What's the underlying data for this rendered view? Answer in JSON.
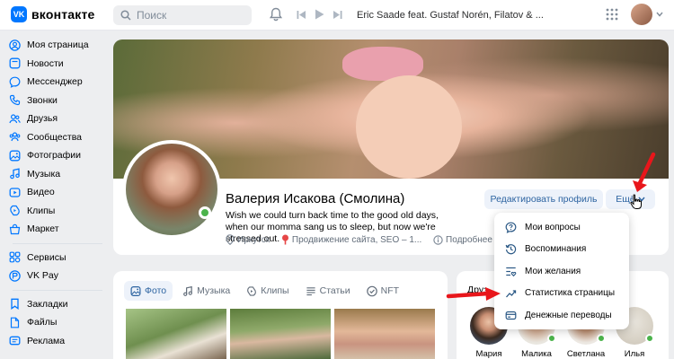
{
  "header": {
    "logo_text": "вконтакте",
    "logo_mark": "VK",
    "search_placeholder": "Поиск",
    "track": "Eric Saade feat. Gustaf Norén, Filatov & ..."
  },
  "sidebar": {
    "group1": [
      {
        "label": "Моя страница",
        "icon": "user-circle-icon"
      },
      {
        "label": "Новости",
        "icon": "newsfeed-icon"
      },
      {
        "label": "Мессенджер",
        "icon": "message-icon"
      },
      {
        "label": "Звонки",
        "icon": "phone-icon"
      },
      {
        "label": "Друзья",
        "icon": "friends-icon"
      },
      {
        "label": "Сообщества",
        "icon": "communities-icon"
      },
      {
        "label": "Фотографии",
        "icon": "photo-icon"
      },
      {
        "label": "Музыка",
        "icon": "music-icon"
      },
      {
        "label": "Видео",
        "icon": "video-icon"
      },
      {
        "label": "Клипы",
        "icon": "clips-icon"
      },
      {
        "label": "Маркет",
        "icon": "market-icon"
      }
    ],
    "group2": [
      {
        "label": "Сервисы",
        "icon": "services-icon"
      },
      {
        "label": "VK Pay",
        "icon": "vkpay-icon"
      }
    ],
    "group3": [
      {
        "label": "Закладки",
        "icon": "bookmark-icon"
      },
      {
        "label": "Файлы",
        "icon": "file-icon"
      },
      {
        "label": "Реклама",
        "icon": "ads-icon"
      }
    ]
  },
  "profile": {
    "name": "Валерия Исакова (Смолина)",
    "status": "Wish we could turn back time to the good old days, when our momma sang us to sleep, but now we're stressed out.",
    "city": "Иркутск",
    "work": "Продвижение сайта, SEO – 1...",
    "more_info": "Подробнее",
    "edit_button": "Редактировать профиль",
    "more_button": "Ещё"
  },
  "dropdown": {
    "items": [
      {
        "label": "Мои вопросы",
        "icon": "question-icon"
      },
      {
        "label": "Воспоминания",
        "icon": "memories-icon"
      },
      {
        "label": "Мои желания",
        "icon": "wishlist-icon"
      },
      {
        "label": "Статистика страницы",
        "icon": "statistics-icon"
      },
      {
        "label": "Денежные переводы",
        "icon": "money-transfer-icon"
      }
    ]
  },
  "tabs": [
    {
      "label": "Фото",
      "icon": "photo-icon",
      "active": true
    },
    {
      "label": "Музыка",
      "icon": "music-icon",
      "active": false
    },
    {
      "label": "Клипы",
      "icon": "clips-icon",
      "active": false
    },
    {
      "label": "Статьи",
      "icon": "articles-icon",
      "active": false
    },
    {
      "label": "NFT",
      "icon": "nft-icon",
      "active": false
    }
  ],
  "friends": {
    "title_visible": "Друз",
    "list": [
      {
        "name": "Мария",
        "online": false
      },
      {
        "name": "Малика",
        "online": true
      },
      {
        "name": "Светлана",
        "online": true
      },
      {
        "name": "Илья",
        "online": true
      }
    ]
  },
  "colors": {
    "accent": "#0077ff",
    "link": "#2d64a1",
    "online": "#4bb34b",
    "arrow": "#e8161b"
  }
}
